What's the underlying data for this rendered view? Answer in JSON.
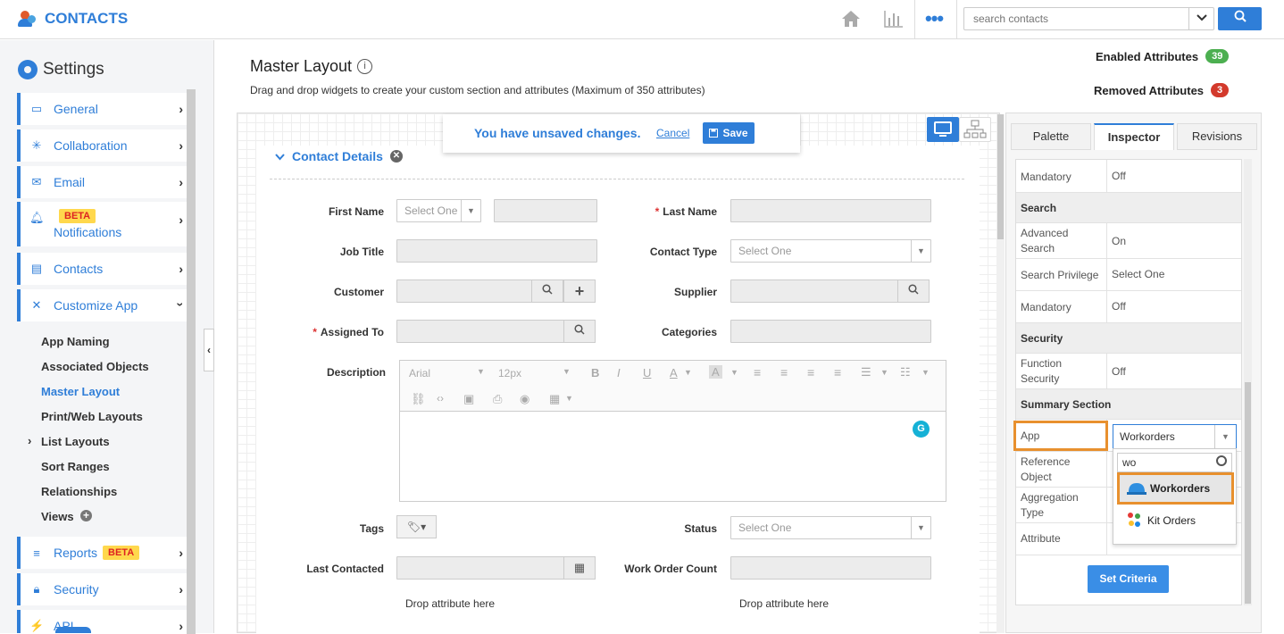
{
  "topbar": {
    "brand": "CONTACTS",
    "search_placeholder": "search contacts",
    "home_icon": "home-icon",
    "chart_icon": "bar-chart-icon",
    "more_icon": "more-dots-icon"
  },
  "sidebar": {
    "title": "Settings",
    "items": [
      {
        "label": "General",
        "icon": "monitor-icon"
      },
      {
        "label": "Collaboration",
        "icon": "collaboration-icon"
      },
      {
        "label": "Email",
        "icon": "envelope-icon"
      },
      {
        "label": "Notifications",
        "icon": "bell-icon",
        "badge": "BETA"
      },
      {
        "label": "Contacts",
        "icon": "contacts-card-icon"
      },
      {
        "label": "Customize App",
        "icon": "tools-icon"
      },
      {
        "label": "Reports",
        "icon": "report-icon",
        "badge": "BETA"
      },
      {
        "label": "Security",
        "icon": "lock-icon"
      },
      {
        "label": "API",
        "icon": "plug-icon"
      }
    ],
    "sub_items": [
      "App Naming",
      "Associated Objects",
      "Master Layout",
      "Print/Web Layouts",
      "List Layouts",
      "Sort Ranges",
      "Relationships",
      "Views"
    ],
    "active_sub": "Master Layout"
  },
  "header": {
    "title": "Master Layout",
    "description": "Drag and drop widgets to create your custom section and attributes (Maximum of 350 attributes)",
    "enabled_label": "Enabled Attributes",
    "enabled_count": "39",
    "removed_label": "Removed Attributes",
    "removed_count": "3",
    "enabled_color": "#4caf50",
    "removed_color": "#d33a2c"
  },
  "notice": {
    "message": "You have unsaved changes.",
    "cancel": "Cancel",
    "save": "Save"
  },
  "form": {
    "section_title": "Contact Details",
    "first_name": "First Name",
    "first_name_select": "Select One",
    "last_name": "Last Name",
    "job_title": "Job Title",
    "contact_type": "Contact Type",
    "contact_type_select": "Select One",
    "customer": "Customer",
    "supplier": "Supplier",
    "assigned_to": "Assigned To",
    "categories": "Categories",
    "description": "Description",
    "editor_font": "Arial",
    "editor_size": "12px",
    "tags": "Tags",
    "status": "Status",
    "status_select": "Select One",
    "last_contacted": "Last Contacted",
    "work_order_count": "Work Order Count",
    "drop_left": "Drop attribute here",
    "drop_right": "Drop attribute here",
    "grammarly": "G"
  },
  "panel": {
    "tabs": [
      "Palette",
      "Inspector",
      "Revisions"
    ],
    "active_tab": "Inspector",
    "rows": {
      "mandatory1_k": "Mandatory",
      "mandatory1_v": "Off",
      "search_head": "Search",
      "advanced_search_k": "Advanced Search",
      "advanced_search_v": "On",
      "search_privilege_k": "Search Privilege",
      "search_privilege_v": "Select One",
      "mandatory2_k": "Mandatory",
      "mandatory2_v": "Off",
      "security_head": "Security",
      "function_security_k": "Function Security",
      "function_security_v": "Off",
      "summary_head": "Summary Section",
      "app_k": "App",
      "reference_object_k": "Reference Object",
      "aggregation_type_k": "Aggregation Type",
      "attribute_k": "Attribute"
    },
    "app_value": "Workorders",
    "dropdown_query": "wo",
    "dropdown_options": [
      "Workorders",
      "Kit Orders"
    ],
    "set_criteria": "Set Criteria",
    "highlight_color": "#e8902e"
  }
}
